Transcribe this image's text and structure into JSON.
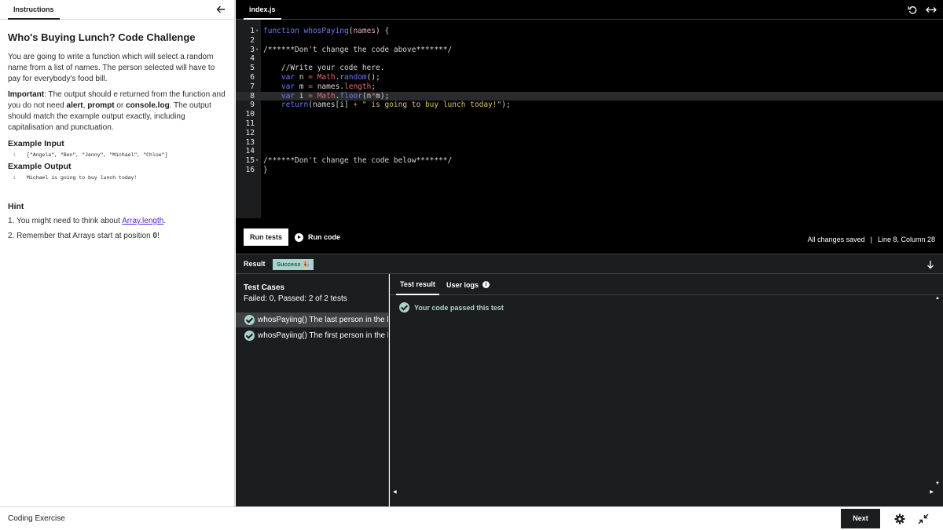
{
  "left": {
    "tab": "Instructions",
    "title": "Who's Buying Lunch? Code Challenge",
    "intro": "You are going to write a function which will select a random name from a list of names. The person selected will have to pay for everybody's food bill.",
    "important_label": "Important",
    "important_text_1": ": The output should e returned from the function and you do not need ",
    "important_alert": "alert",
    "important_sep1": ", ",
    "important_prompt": "prompt",
    "important_or": " or ",
    "important_console": "console.log",
    "important_text_2": ". The output should match the example output exactly, including capitalisation and punctuation.",
    "example_input_title": "Example Input",
    "example_input_ln": "1",
    "example_input_code": "[\"Angela\", \"Ben\", \"Jenny\", \"Michael\", \"Chloe\"]",
    "example_output_title": "Example Output",
    "example_output_ln": "1",
    "example_output_name": "Michael",
    "example_output_is": "is",
    "example_output_rest": "going to buy lunch today!",
    "hint_title": "Hint",
    "hint1_pre": "1. You might need to think about ",
    "hint1_link": "Array.length",
    "hint1_post": ".",
    "hint2_pre": "2. Remember that Arrays start at position ",
    "hint2_bold": "0",
    "hint2_post": "!"
  },
  "editor": {
    "tab": "index.js",
    "lines": [
      "1",
      "2",
      "3",
      "4",
      "5",
      "6",
      "7",
      "8",
      "9",
      "10",
      "11",
      "12",
      "13",
      "14",
      "15",
      "16"
    ],
    "run_tests": "Run tests",
    "run_code": "Run code",
    "saved_status": "All changes saved",
    "separator": "|",
    "cursor_position": "Line 8, Column 28"
  },
  "result": {
    "label": "Result",
    "badge": "Success 🎉",
    "test_cases_title": "Test Cases",
    "test_cases_summary": "Failed: 0, Passed: 2 of 2 tests",
    "test_cases": [
      {
        "label": "whosPayiing() The last person in the list",
        "selected": true
      },
      {
        "label": "whosPayiing() The first person in the list",
        "selected": false
      }
    ],
    "tab_test_result": "Test result",
    "tab_user_logs": "User logs",
    "passed_message": "Your code passed this test"
  },
  "footer": {
    "title": "Coding Exercise",
    "next": "Next"
  },
  "colors": {
    "success_badge_bg": "#acd2cc",
    "dark_bg": "#1c1d1f",
    "link": "#5624d0"
  }
}
